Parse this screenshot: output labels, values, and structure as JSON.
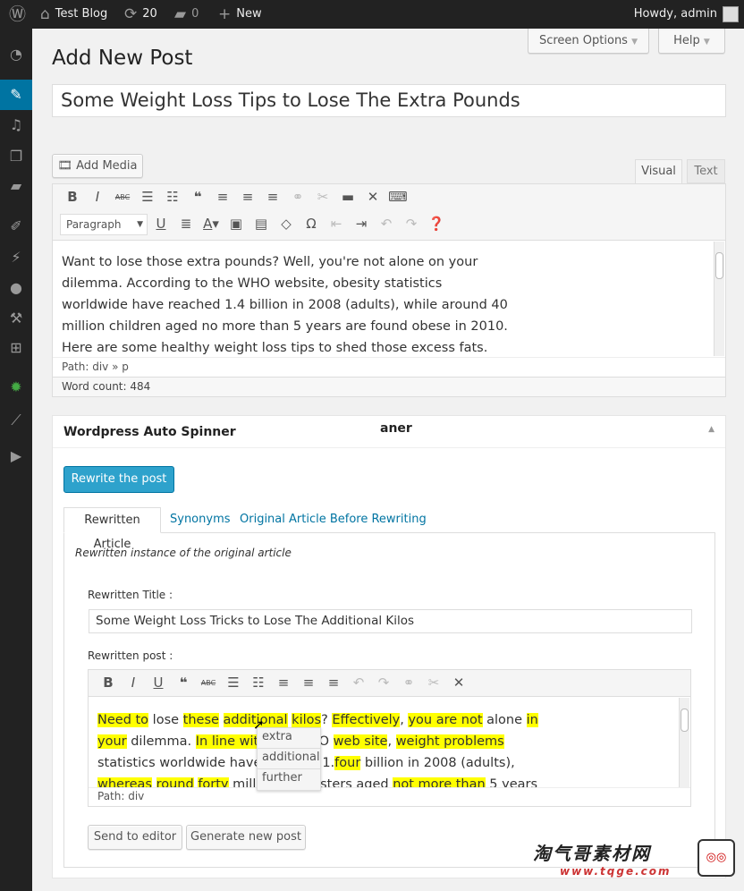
{
  "adminbar": {
    "site": "Test Blog",
    "updates": "20",
    "comments": "0",
    "new": "New",
    "howdy": "Howdy, admin"
  },
  "sidebar": {
    "items": [
      "dashboard-icon",
      "posts-icon",
      "media-icon",
      "pages-icon",
      "comments-icon",
      "appearance-icon",
      "plugins-icon",
      "users-icon",
      "tools-icon",
      "settings-icon",
      "spinner-plugin-icon",
      "analytics-icon",
      "video-icon"
    ],
    "active_color": "#0074a2"
  },
  "header": {
    "screen_options": "Screen Options",
    "help": "Help",
    "page_title": "Add New Post"
  },
  "post": {
    "title": "Some Weight Loss Tips to Lose The Extra Pounds",
    "add_media": "Add Media",
    "tab_visual": "Visual",
    "tab_text": "Text",
    "format": "Paragraph",
    "content_lines": [
      "Want to lose those extra pounds? Well, you're not alone on your",
      "dilemma. According to the WHO website, obesity statistics",
      "worldwide have reached 1.4 billion in 2008 (adults), while around 40",
      "million children aged no more than 5 years are found obese in 2010.",
      "Here are some healthy weight loss tips to shed those excess fats."
    ],
    "path": "Path: div » p",
    "word_count": "Word count: 484"
  },
  "spinner": {
    "title": "Wordpress Auto Spinner",
    "artifact": "aner",
    "rewrite_button": "Rewrite the post",
    "tabs": [
      "Rewritten Article",
      "Synonyms",
      "Original Article Before Rewriting"
    ],
    "description": "Rewritten instance of the original article",
    "title_label": "Rewritten Title :",
    "rewritten_title": "Some Weight Loss Tricks to Lose The Additional Kilos",
    "post_label": "Rewritten post :",
    "path": "Path: div",
    "highlight_color": "#ffff00",
    "synonyms": [
      "extra",
      "additional",
      "further"
    ],
    "send_button": "Send to editor",
    "generate_button": "Generate new post"
  },
  "watermark": {
    "text": "淘气哥素材网",
    "url": "www.tqge.com"
  }
}
